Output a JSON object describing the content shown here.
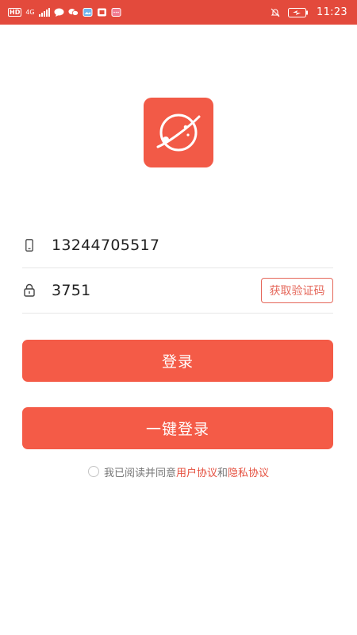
{
  "status_bar": {
    "hd": "HD",
    "network": "4G",
    "time": "11:23"
  },
  "icons": {
    "logo": "planet-icon",
    "phone": "phone-icon",
    "lock": "lock-icon"
  },
  "colors": {
    "accent": "#f45b47",
    "status_bar": "#e34a3c",
    "link": "#e5503f"
  },
  "form": {
    "phone_value": "13244705517",
    "code_value": "3751",
    "get_code_label": "获取验证码"
  },
  "buttons": {
    "login": "登录",
    "one_key_login": "一键登录"
  },
  "agreement": {
    "prefix": "我已阅读并同意",
    "user_agreement": "用户协议",
    "conjunction": "和",
    "privacy_policy": "隐私协议"
  }
}
